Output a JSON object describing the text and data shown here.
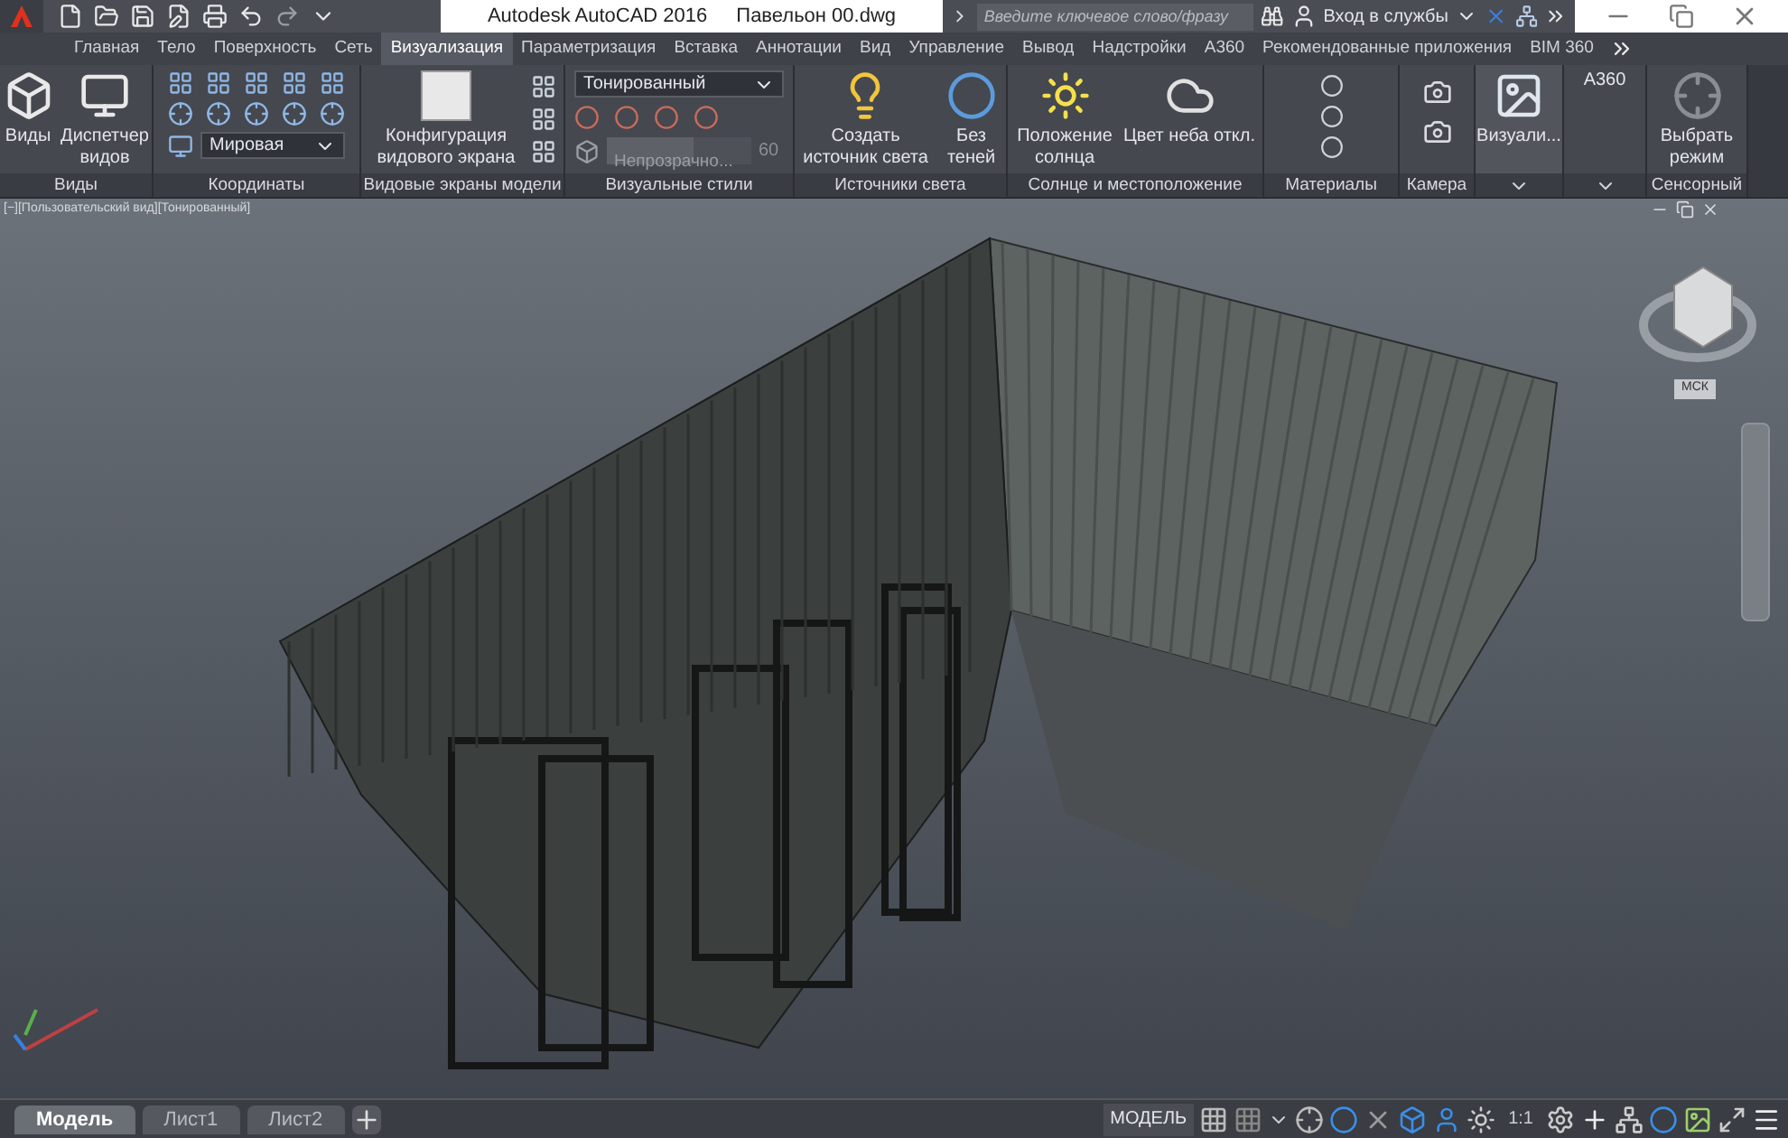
{
  "title_bar": {
    "app_title": "Autodesk AutoCAD 2016",
    "file_name": "Павельон 00.dwg",
    "search": {
      "placeholder": "Введите ключевое слово/фразу"
    },
    "sign_in": "Вход в службы"
  },
  "ribbon_tabs": [
    {
      "label": "Главная",
      "selected": false
    },
    {
      "label": "Тело",
      "selected": false
    },
    {
      "label": "Поверхность",
      "selected": false
    },
    {
      "label": "Сеть",
      "selected": false
    },
    {
      "label": "Визуализация",
      "selected": true
    },
    {
      "label": "Параметризация",
      "selected": false
    },
    {
      "label": "Вставка",
      "selected": false
    },
    {
      "label": "Аннотации",
      "selected": false
    },
    {
      "label": "Вид",
      "selected": false
    },
    {
      "label": "Управление",
      "selected": false
    },
    {
      "label": "Вывод",
      "selected": false
    },
    {
      "label": "Надстройки",
      "selected": false
    },
    {
      "label": "A360",
      "selected": false
    },
    {
      "label": "Рекомендованные приложения",
      "selected": false
    },
    {
      "label": "BIM 360",
      "selected": false
    }
  ],
  "panels": [
    {
      "kind": "views",
      "title": "Виды",
      "buttons": [
        "Виды",
        "Диспетчер видов"
      ]
    },
    {
      "kind": "coords",
      "title": "Координаты",
      "dropdown": "Мировая"
    },
    {
      "kind": "viewports",
      "title": "Видовые экраны модели",
      "button": "Конфигурация видового экрана"
    },
    {
      "kind": "styles",
      "title": "Визуальные стили",
      "dropdown": "Тонированный",
      "opacity": {
        "label": "Непрозрачно...",
        "value": "60",
        "level": 0.6
      }
    },
    {
      "kind": "lights",
      "title": "Источники света",
      "buttons": [
        "Создать источник света",
        "Без теней"
      ]
    },
    {
      "kind": "sun",
      "title": "Солнце и местоположение",
      "buttons": [
        "Положение солнца",
        "Цвет неба откл."
      ]
    },
    {
      "kind": "materials",
      "title": "Материалы"
    },
    {
      "kind": "camera",
      "title": "Камера"
    },
    {
      "kind": "render",
      "button": "Визуали..."
    },
    {
      "kind": "a360",
      "button": "A360"
    },
    {
      "kind": "touch",
      "title": "Сенсорный",
      "button": "Выбрать режим"
    }
  ],
  "viewport": {
    "label": "[−][Пользовательский вид][Тонированный]",
    "ucs": "МСК"
  },
  "layout_tabs": [
    {
      "label": "Модель",
      "selected": true
    },
    {
      "label": "Лист1",
      "selected": false
    },
    {
      "label": "Лист2",
      "selected": false
    }
  ],
  "status_bar": {
    "space": "МОДЕЛЬ",
    "scale": "1:1"
  }
}
